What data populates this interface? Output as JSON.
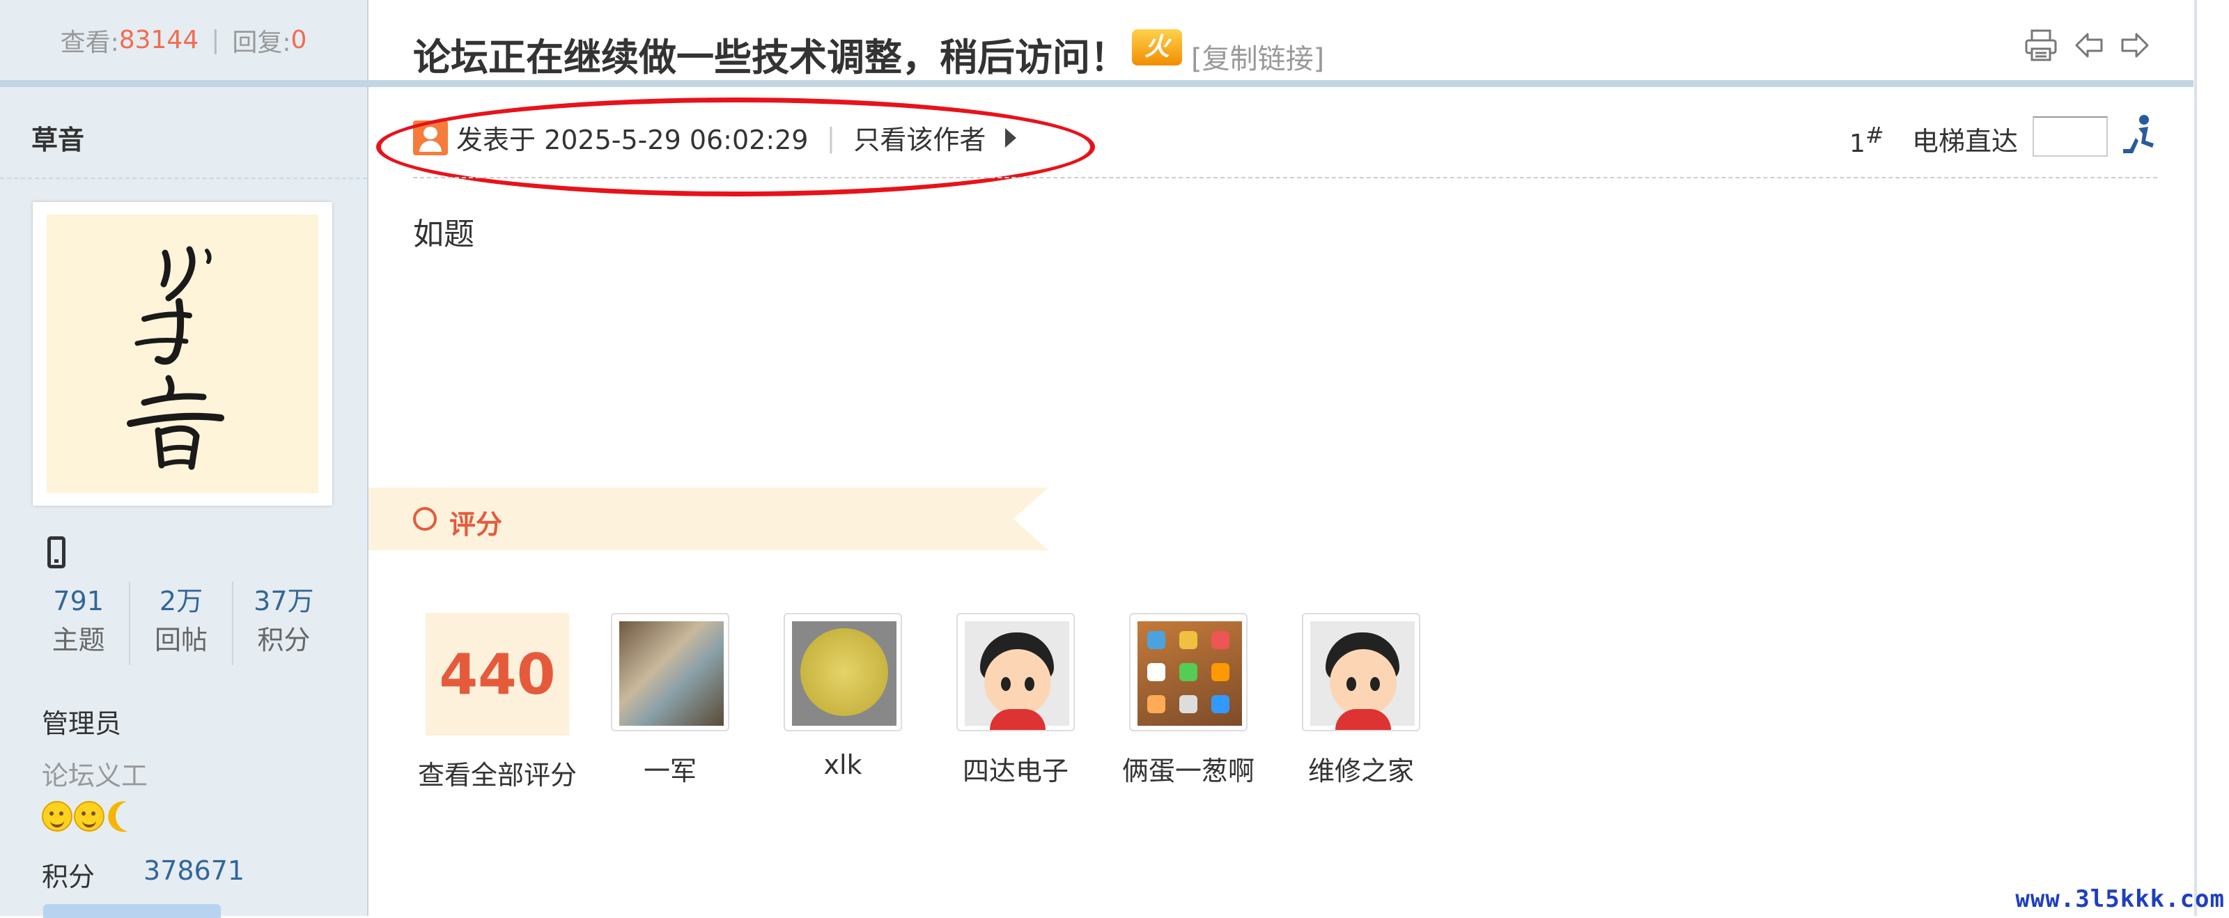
{
  "stats": {
    "views_label": "查看:",
    "views": "83144",
    "replies_label": "回复:",
    "replies": "0"
  },
  "thread": {
    "title": "论坛正在继续做一些技术调整，稍后访问！",
    "hot_badge": "火",
    "copy_link": "[复制链接]"
  },
  "author": {
    "name": "草音",
    "user_stats": [
      {
        "value": "791",
        "label": "主题"
      },
      {
        "value": "2万",
        "label": "回帖"
      },
      {
        "value": "37万",
        "label": "积分"
      }
    ],
    "group": "管理员",
    "custom_title": "论坛义工",
    "score_label": "积分",
    "score_value": "378671"
  },
  "post": {
    "posted_at": "发表于 2025-5-29 06:02:29",
    "only_author": "只看该作者",
    "floor_num": "1",
    "floor_mark": "#",
    "elevator_label": "电梯直达",
    "elevator_value": "",
    "content": "如题"
  },
  "rating": {
    "label": "评分",
    "total": "440",
    "view_all": "查看全部评分",
    "raters": [
      {
        "name": "一军",
        "avatar": "glass-bottles"
      },
      {
        "name": "xlk",
        "avatar": "circuit-board"
      },
      {
        "name": "四达电子",
        "avatar": "cartoon-boy"
      },
      {
        "name": "俩蛋一葱啊",
        "avatar": "phone-home-screen"
      },
      {
        "name": "维修之家",
        "avatar": "cartoon-boy"
      }
    ]
  },
  "watermark": "www.3l5kkk.com",
  "colors": {
    "accent": "#f26c4f",
    "link": "#336699",
    "highlight_ellipse": "#e8121a",
    "sidebar_bg": "#e5edf2"
  }
}
